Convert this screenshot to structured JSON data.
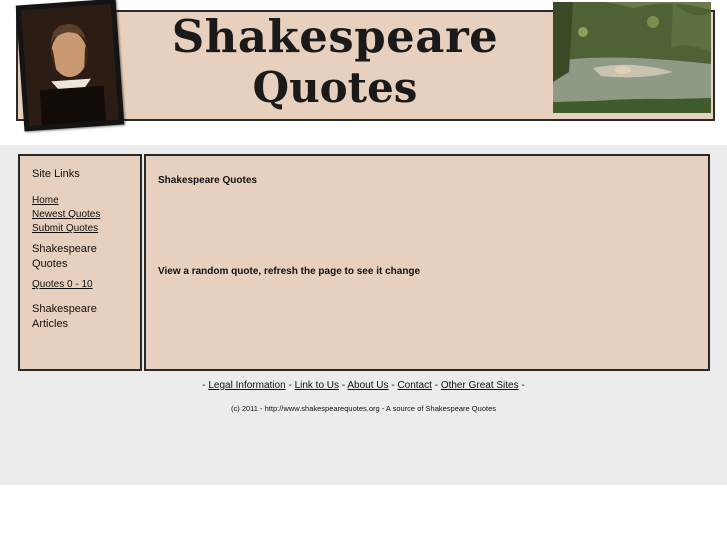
{
  "header": {
    "logo_line1": "Shakespeare",
    "logo_line2": "Quotes"
  },
  "sidebar": {
    "heading": "Site Links",
    "links": [
      "Home",
      "Newest Quotes",
      "Submit Quotes"
    ],
    "section1": "Shakespeare Quotes",
    "section1_link": "Quotes 0 - 10",
    "section2": "Shakespeare Articles"
  },
  "content": {
    "title": "Shakespeare Quotes",
    "random_text": "View a random quote, refresh the page to see it change"
  },
  "footer": {
    "links": [
      "Legal Information",
      "Link to Us",
      "About Us",
      "Contact",
      "Other Great Sites"
    ],
    "separator": "-",
    "copyright": "(c) 2011 - http://www.shakespearequotes.org - A source of Shakespeare Quotes"
  },
  "colors": {
    "panel": "#e7d0bd",
    "band": "#ececec",
    "border": "#2a2a2a"
  }
}
